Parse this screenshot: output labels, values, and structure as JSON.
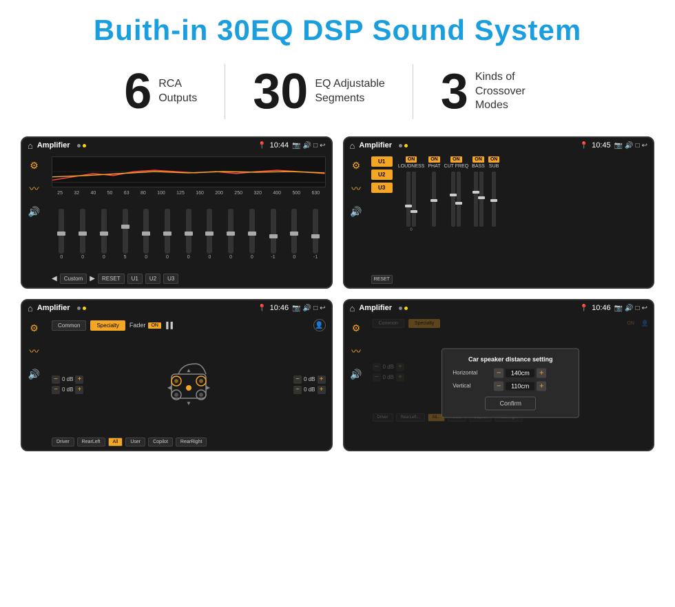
{
  "header": {
    "title": "Buith-in 30EQ DSP Sound System"
  },
  "stats": [
    {
      "number": "6",
      "label": "RCA\nOutputs"
    },
    {
      "number": "30",
      "label": "EQ Adjustable\nSegments"
    },
    {
      "number": "3",
      "label": "Kinds of\nCrossover Modes"
    }
  ],
  "screens": [
    {
      "id": "screen1",
      "statusBar": {
        "appName": "Amplifier",
        "time": "10:44"
      },
      "type": "eq",
      "freqLabels": [
        "25",
        "32",
        "40",
        "50",
        "63",
        "80",
        "100",
        "125",
        "160",
        "200",
        "250",
        "320",
        "400",
        "500",
        "630"
      ],
      "sliderValues": [
        "0",
        "0",
        "0",
        "5",
        "0",
        "0",
        "0",
        "0",
        "0",
        "0",
        "-1",
        "0",
        "-1"
      ],
      "bottomButtons": [
        "Custom",
        "RESET",
        "U1",
        "U2",
        "U3"
      ]
    },
    {
      "id": "screen2",
      "statusBar": {
        "appName": "Amplifier",
        "time": "10:45"
      },
      "type": "dsp",
      "presets": [
        "U1",
        "U2",
        "U3"
      ],
      "columns": [
        {
          "label": "LOUDNESS",
          "on": true
        },
        {
          "label": "PHAT",
          "on": true
        },
        {
          "label": "CUT FREQ",
          "on": true
        },
        {
          "label": "BASS",
          "on": true
        },
        {
          "label": "SUB",
          "on": true
        }
      ],
      "bottomButton": "RESET"
    },
    {
      "id": "screen3",
      "statusBar": {
        "appName": "Amplifier",
        "time": "10:46"
      },
      "type": "fader",
      "tabs": [
        "Common",
        "Specialty"
      ],
      "faderLabel": "Fader",
      "faderOn": "ON",
      "controls": [
        {
          "label": "0 dB"
        },
        {
          "label": "0 dB"
        },
        {
          "label": "0 dB"
        },
        {
          "label": "0 dB"
        }
      ],
      "bottomButtons": [
        "Driver",
        "RearLeft",
        "All",
        "User",
        "Copilot",
        "RearRight"
      ]
    },
    {
      "id": "screen4",
      "statusBar": {
        "appName": "Amplifier",
        "time": "10:46"
      },
      "type": "dialog",
      "dialog": {
        "title": "Car speaker distance setting",
        "fields": [
          {
            "label": "Horizontal",
            "value": "140cm"
          },
          {
            "label": "Vertical",
            "value": "110cm"
          }
        ],
        "confirmLabel": "Confirm"
      }
    }
  ]
}
